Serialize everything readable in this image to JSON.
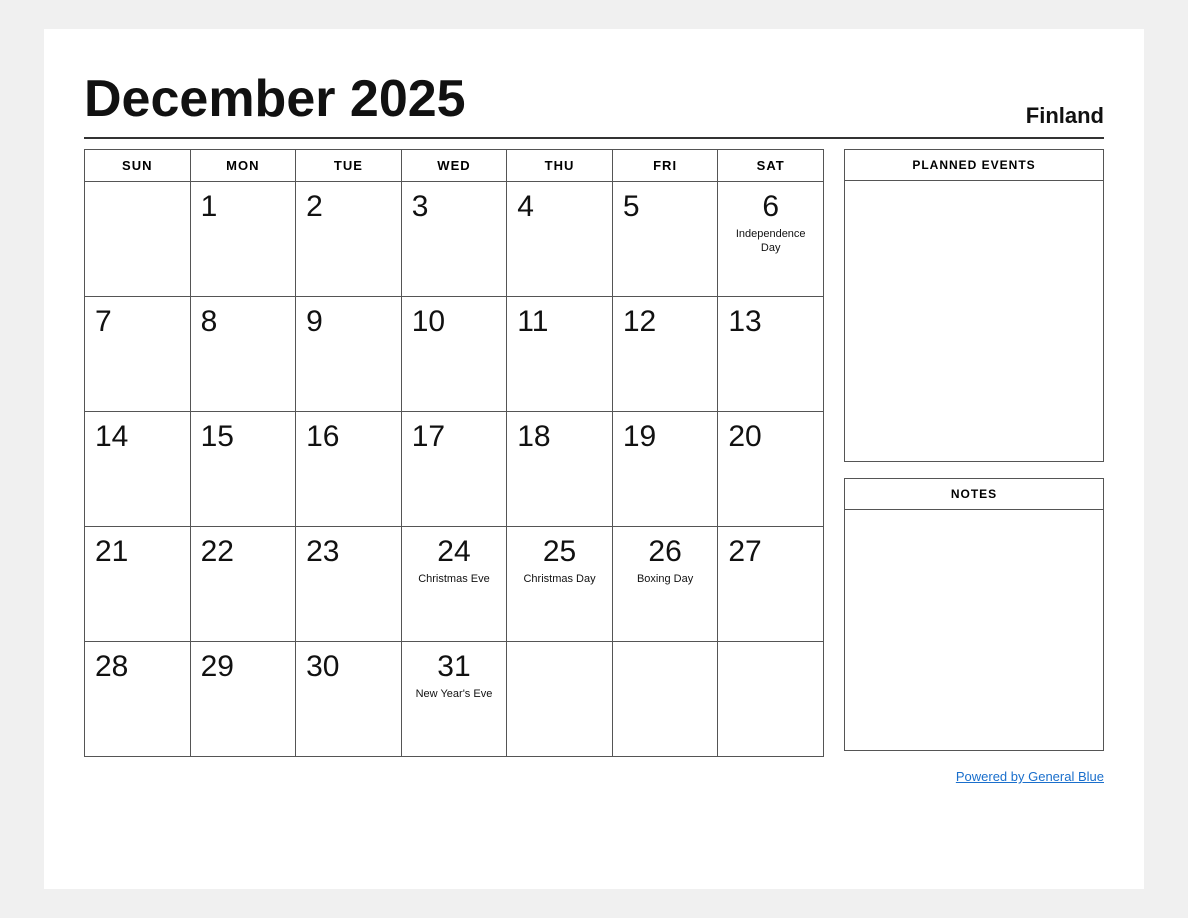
{
  "header": {
    "title": "December 2025",
    "country": "Finland"
  },
  "days_of_week": [
    "SUN",
    "MON",
    "TUE",
    "WED",
    "THU",
    "FRI",
    "SAT"
  ],
  "weeks": [
    [
      {
        "day": "",
        "holiday": ""
      },
      {
        "day": "1",
        "holiday": ""
      },
      {
        "day": "2",
        "holiday": ""
      },
      {
        "day": "3",
        "holiday": ""
      },
      {
        "day": "4",
        "holiday": ""
      },
      {
        "day": "5",
        "holiday": ""
      },
      {
        "day": "6",
        "holiday": "Independence Day"
      }
    ],
    [
      {
        "day": "7",
        "holiday": ""
      },
      {
        "day": "8",
        "holiday": ""
      },
      {
        "day": "9",
        "holiday": ""
      },
      {
        "day": "10",
        "holiday": ""
      },
      {
        "day": "11",
        "holiday": ""
      },
      {
        "day": "12",
        "holiday": ""
      },
      {
        "day": "13",
        "holiday": ""
      }
    ],
    [
      {
        "day": "14",
        "holiday": ""
      },
      {
        "day": "15",
        "holiday": ""
      },
      {
        "day": "16",
        "holiday": ""
      },
      {
        "day": "17",
        "holiday": ""
      },
      {
        "day": "18",
        "holiday": ""
      },
      {
        "day": "19",
        "holiday": ""
      },
      {
        "day": "20",
        "holiday": ""
      }
    ],
    [
      {
        "day": "21",
        "holiday": ""
      },
      {
        "day": "22",
        "holiday": ""
      },
      {
        "day": "23",
        "holiday": ""
      },
      {
        "day": "24",
        "holiday": "Christmas Eve"
      },
      {
        "day": "25",
        "holiday": "Christmas Day"
      },
      {
        "day": "26",
        "holiday": "Boxing Day"
      },
      {
        "day": "27",
        "holiday": ""
      }
    ],
    [
      {
        "day": "28",
        "holiday": ""
      },
      {
        "day": "29",
        "holiday": ""
      },
      {
        "day": "30",
        "holiday": ""
      },
      {
        "day": "31",
        "holiday": "New Year's Eve"
      },
      {
        "day": "",
        "holiday": ""
      },
      {
        "day": "",
        "holiday": ""
      },
      {
        "day": "",
        "holiday": ""
      }
    ]
  ],
  "sidebar": {
    "planned_events_label": "PLANNED EVENTS",
    "notes_label": "NOTES"
  },
  "footer": {
    "powered_by_text": "Powered by General Blue",
    "powered_by_url": "#"
  }
}
